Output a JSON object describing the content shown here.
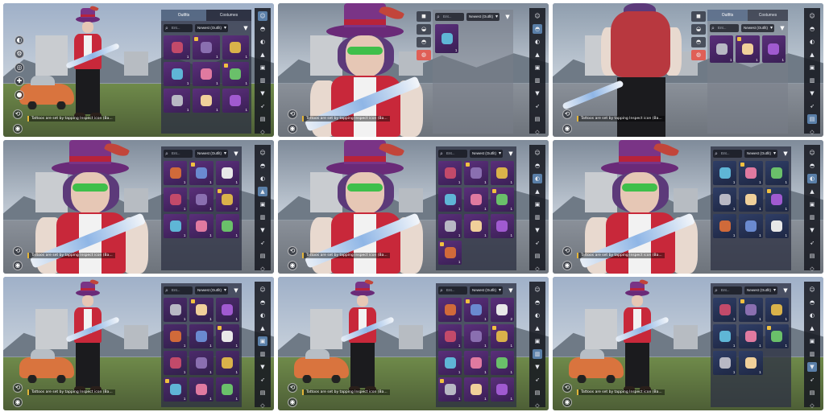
{
  "tabs": {
    "outfits": "Outfits",
    "costumes": "Costumes"
  },
  "tabs_alt": {
    "outfits": "Outfits",
    "costumes": "Costumes"
  },
  "sort_label": "Newest (Outfit)",
  "search_placeholder": "Ent...",
  "hint_text": "Tattoos are set by tapping Inspect icon (Ba...",
  "icons": {
    "filter": "filter-icon",
    "search": "search-icon",
    "rail": [
      "avatar-icon",
      "helmet-icon",
      "mask-icon",
      "hat-icon",
      "top-icon",
      "pants-icon",
      "shoe-icon",
      "gun-icon",
      "backpack-icon",
      "vehicle-icon"
    ]
  },
  "panels": [
    {
      "category": "outfits",
      "counts": [
        "1",
        "1",
        "1",
        "1",
        "1",
        "1",
        "1",
        "1",
        "1"
      ]
    },
    {
      "category": "helmets",
      "counts": [
        "1"
      ]
    },
    {
      "category": "backpacks",
      "counts": [
        "1",
        "1",
        "1"
      ]
    },
    {
      "category": "hats",
      "counts": [
        "1",
        "1",
        "1",
        "1",
        "1",
        "2",
        "1",
        "1",
        "1"
      ]
    },
    {
      "category": "glasses",
      "counts": [
        "1",
        "1",
        "1",
        "1",
        "1",
        "1",
        "1",
        "1",
        "1",
        "1"
      ]
    },
    {
      "category": "masks",
      "counts": [
        "1",
        "1",
        "1",
        "1",
        "1",
        "1",
        "1",
        "1",
        "1"
      ]
    },
    {
      "category": "tops",
      "counts": [
        "1",
        "1",
        "1",
        "1",
        "1",
        "1",
        "1",
        "1",
        "1",
        "1",
        "1",
        "1"
      ]
    },
    {
      "category": "pants",
      "counts": [
        "1",
        "1",
        "2",
        "1",
        "1",
        "1",
        "1",
        "1",
        "1",
        "1",
        "1",
        "1"
      ]
    },
    {
      "category": "shoes",
      "counts": [
        "1",
        "1",
        "1",
        "1",
        "1",
        "1",
        "1",
        "1"
      ]
    }
  ]
}
